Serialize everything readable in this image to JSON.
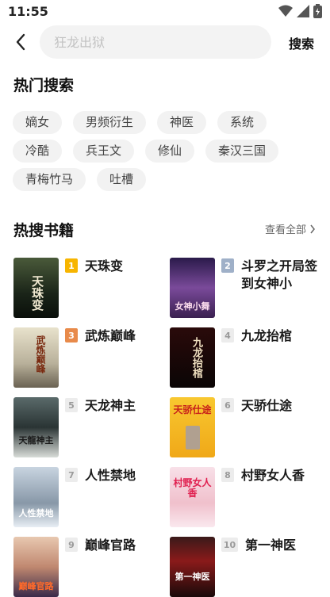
{
  "status": {
    "time": "11:55"
  },
  "search": {
    "placeholder": "狂龙出狱",
    "button_label": "搜索"
  },
  "hot_search": {
    "title": "热门搜索",
    "rows": [
      [
        "嫡女",
        "男频衍生",
        "神医",
        "系统"
      ],
      [
        "冷酷",
        "兵王文",
        "修仙",
        "秦汉三国"
      ],
      [
        "青梅竹马",
        "吐槽"
      ]
    ]
  },
  "hot_books": {
    "title": "热搜书籍",
    "view_all_label": "查看全部",
    "items": [
      {
        "rank": "1",
        "title": "天珠变",
        "cover_text": "天珠变",
        "cover_color": "#2a3a2a"
      },
      {
        "rank": "2",
        "title": "斗罗之开局签到女神小",
        "cover_text": "女神小舞",
        "cover_color": "#5a3a7a"
      },
      {
        "rank": "3",
        "title": "武炼巅峰",
        "cover_text": "武炼巅峰",
        "cover_color": "#c9c2a8"
      },
      {
        "rank": "4",
        "title": "九龙抬棺",
        "cover_text": "九龙抬棺",
        "cover_color": "#1a0a0a"
      },
      {
        "rank": "5",
        "title": "天龙神主",
        "cover_text": "天龍神主",
        "cover_color": "#3a4a4a"
      },
      {
        "rank": "6",
        "title": "天骄仕途",
        "cover_text": "天骄仕途",
        "cover_color": "#f5b820"
      },
      {
        "rank": "7",
        "title": "人性禁地",
        "cover_text": "人性禁地",
        "cover_color": "#a8b8c8"
      },
      {
        "rank": "8",
        "title": "村野女人香",
        "cover_text": "村野女人香",
        "cover_color": "#f0d0d8"
      },
      {
        "rank": "9",
        "title": "巅峰官路",
        "cover_text": "巅峰官路",
        "cover_color": "#c89a80"
      },
      {
        "rank": "10",
        "title": "第一神医",
        "cover_text": "第一神医",
        "cover_color": "#2a1a1a"
      }
    ]
  }
}
